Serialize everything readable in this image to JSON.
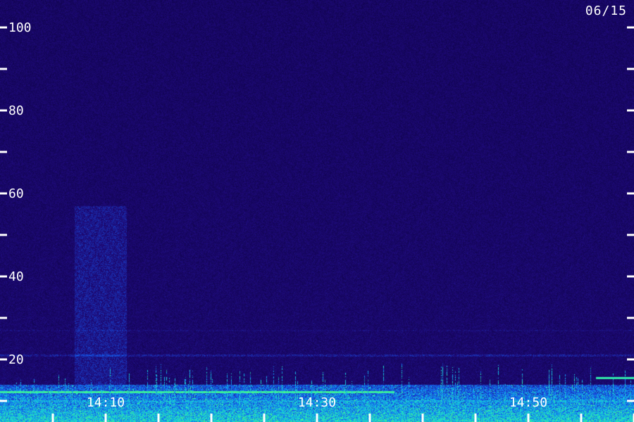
{
  "date_label": "06/15",
  "colors": {
    "background": "#1a0850",
    "tick": "#ffffff",
    "low_band": "#20b8e8",
    "hot_line": "#40ff80"
  },
  "chart_data": {
    "type": "heatmap",
    "title": "",
    "xlabel": "",
    "ylabel": "",
    "y_ticks_labeled": [
      20,
      40,
      60,
      80,
      100
    ],
    "y_ticks_all": [
      0,
      10,
      20,
      30,
      40,
      50,
      60,
      70,
      80,
      90,
      100
    ],
    "ylim": [
      0,
      102
    ],
    "x_tick_labels": [
      "14:10",
      "14:30",
      "14:50"
    ],
    "x_ticks_minutes": [
      14.0,
      14.083,
      14.167,
      14.25,
      14.333,
      14.417,
      14.5,
      14.583,
      14.667,
      14.75,
      14.833,
      14.917,
      15.0
    ],
    "xlim_note": "time axis labeled in HH:MM",
    "x_labeled_positions_minutes": [
      10,
      30,
      50
    ],
    "x_range_minutes": [
      5,
      64.2
    ],
    "features": [
      {
        "kind": "broadband_burst",
        "x_start_min": 11,
        "x_end_min": 16,
        "y_low": 14,
        "y_high": 57
      },
      {
        "kind": "strong_low_band",
        "y_low": 0,
        "y_high": 14
      },
      {
        "kind": "faint_horizontal_line",
        "y": 21
      },
      {
        "kind": "hot_line",
        "y": 3
      }
    ]
  }
}
